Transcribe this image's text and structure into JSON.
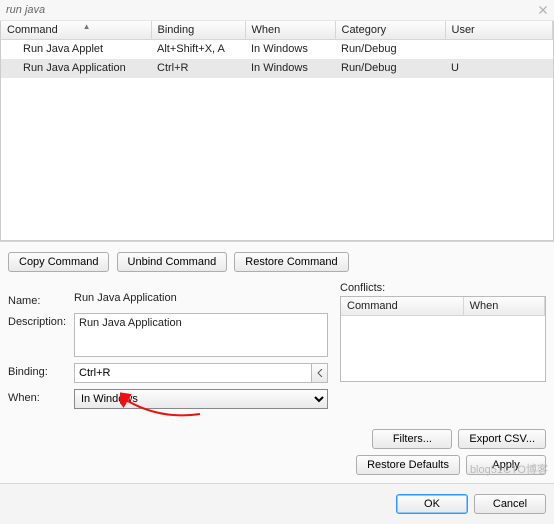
{
  "search": {
    "value": "run java"
  },
  "columns": [
    "Command",
    "Binding",
    "When",
    "Category",
    "User"
  ],
  "rows": [
    {
      "command": "Run Java Applet",
      "binding": "Alt+Shift+X, A",
      "when": "In Windows",
      "category": "Run/Debug",
      "user": ""
    },
    {
      "command": "Run Java Application",
      "binding": "Ctrl+R",
      "when": "In Windows",
      "category": "Run/Debug",
      "user": "U"
    }
  ],
  "buttons": {
    "copy": "Copy Command",
    "unbind": "Unbind Command",
    "restore": "Restore Command",
    "filters": "Filters...",
    "export": "Export CSV...",
    "restoreDefaults": "Restore Defaults",
    "apply": "Apply",
    "ok": "OK",
    "cancel": "Cancel"
  },
  "labels": {
    "name": "Name:",
    "description": "Description:",
    "binding": "Binding:",
    "when": "When:",
    "conflicts": "Conflicts:"
  },
  "detail": {
    "name": "Run Java Application",
    "description": "Run Java Application",
    "binding": "Ctrl+R",
    "when": "In Windows"
  },
  "conflictsColumns": [
    "Command",
    "When"
  ],
  "watermark": "blog51CTO博客"
}
